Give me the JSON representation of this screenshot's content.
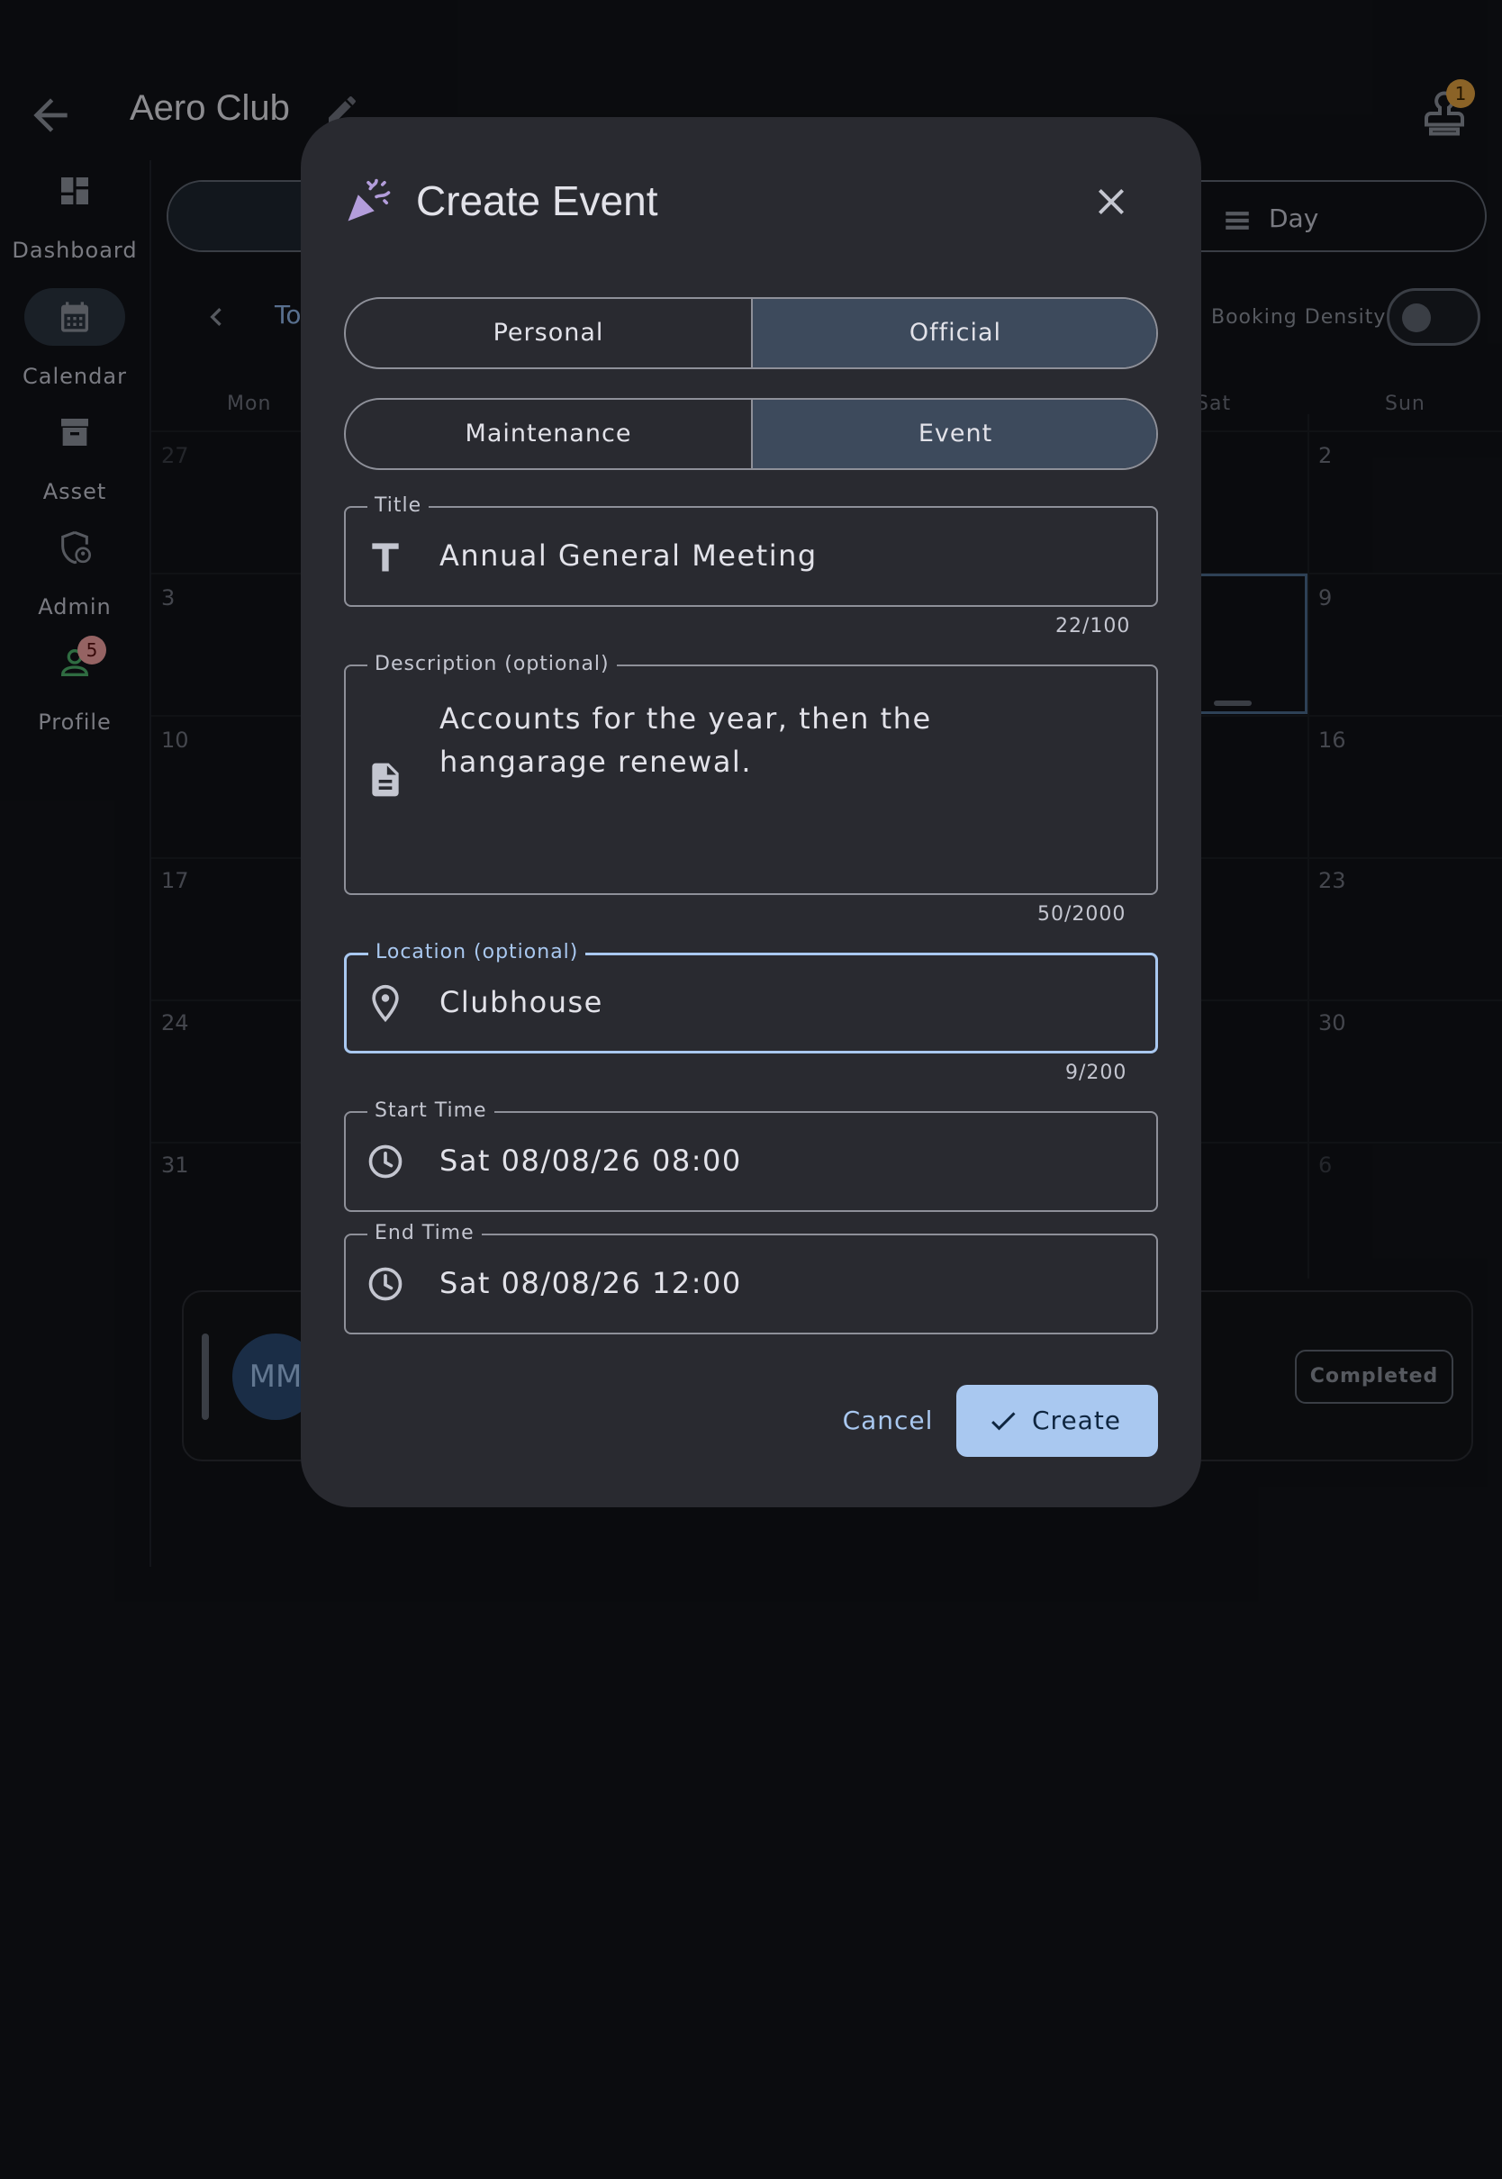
{
  "app": {
    "title": "Aero Club",
    "account_badge": "1"
  },
  "nav": {
    "items": [
      {
        "label": "Dashboard",
        "icon": "dashboard-icon"
      },
      {
        "label": "Calendar",
        "icon": "calendar-icon",
        "active": true
      },
      {
        "label": "Asset",
        "icon": "archive-icon"
      },
      {
        "label": "Admin",
        "icon": "admin-shield-icon"
      },
      {
        "label": "Profile",
        "icon": "person-icon",
        "badge": "5"
      }
    ]
  },
  "calendar": {
    "view_day_label": "Day",
    "today_label": "To",
    "booking_density_label": "Booking Density",
    "weekdays": {
      "mon": "Mon",
      "sat": "Sat",
      "sun": "Sun"
    },
    "days": {
      "r1_mon": "27",
      "r1_sun": "2",
      "r2_mon": "3",
      "r2_sun": "9",
      "r3_mon": "10",
      "r3_sun": "16",
      "r4_mon": "17",
      "r4_sun": "23",
      "r5_mon": "24",
      "r5_sun": "30",
      "r6_mon": "31",
      "r6_sun": "6"
    },
    "booking": {
      "avatar": "MM",
      "status": "Completed"
    }
  },
  "dialog": {
    "title": "Create Event",
    "scope": {
      "options": [
        "Personal",
        "Official"
      ],
      "selected": "Official"
    },
    "kind": {
      "options": [
        "Maintenance",
        "Event"
      ],
      "selected": "Event"
    },
    "title_field": {
      "label": "Title",
      "value": "Annual General Meeting",
      "counter": "22/100"
    },
    "description_field": {
      "label": "Description (optional)",
      "value": "Accounts for the year, then the hangarage renewal.",
      "counter": "50/2000"
    },
    "location_field": {
      "label": "Location (optional)",
      "value": "Clubhouse",
      "counter": "9/200"
    },
    "start_field": {
      "label": "Start Time",
      "value": "Sat 08/08/26 08:00"
    },
    "end_field": {
      "label": "End Time",
      "value": "Sat 08/08/26 12:00"
    },
    "cancel_label": "Cancel",
    "create_label": "Create"
  },
  "colors": {
    "background": "#111318",
    "dialog": "#292a30",
    "accent": "#a9c8f0",
    "segment_selected": "#3d4a5c",
    "party_icon": "#b39ddb"
  }
}
